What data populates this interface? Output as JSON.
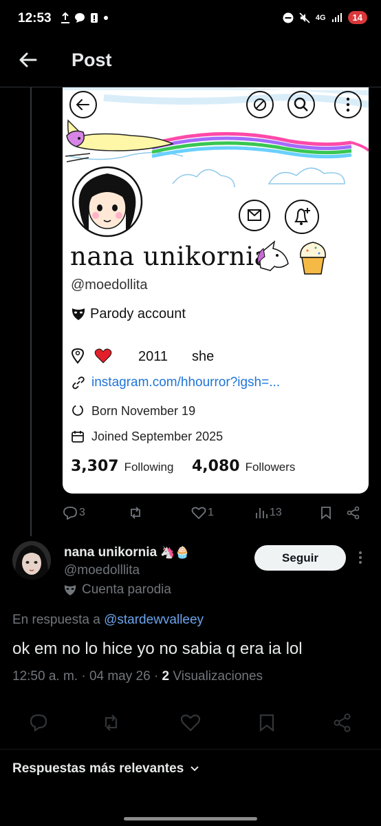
{
  "status_bar": {
    "time": "12:53",
    "network": "4G",
    "battery": "14"
  },
  "header": {
    "title": "Post"
  },
  "screenshot_card": {
    "display_name": "nana unikornia",
    "handle": "@moedollita",
    "parody": "Parody account",
    "year": "2011",
    "pronoun": "she",
    "link": "instagram.com/hhourror?igsh=...",
    "born": "Born November 19",
    "joined": "Joined September 2025",
    "following_count": "3,307",
    "following_label": "Following",
    "followers_count": "4,080",
    "followers_label": "Followers"
  },
  "quoted_actions": {
    "replies": "3",
    "likes": "1",
    "views": "13"
  },
  "author": {
    "name": "nana unikornia",
    "emojis": "🦄🧁",
    "handle": "@moedolllita",
    "parody_label": "Cuenta parodia",
    "follow_label": "Seguir"
  },
  "post": {
    "reply_prefix": "En respuesta a",
    "reply_mention": "@stardewvalleey",
    "text": "ok em no lo hice yo no sabia q era ia lol",
    "time_date": "12:50 a. m. · 04 may 26 · ",
    "views_count": "2",
    "views_label": "Visualizaciones"
  },
  "replies_sort": {
    "label": "Respuestas más relevantes"
  },
  "colors": {
    "accent_blue": "#6ca5ec",
    "muted": "#71767b",
    "background": "#000000"
  }
}
